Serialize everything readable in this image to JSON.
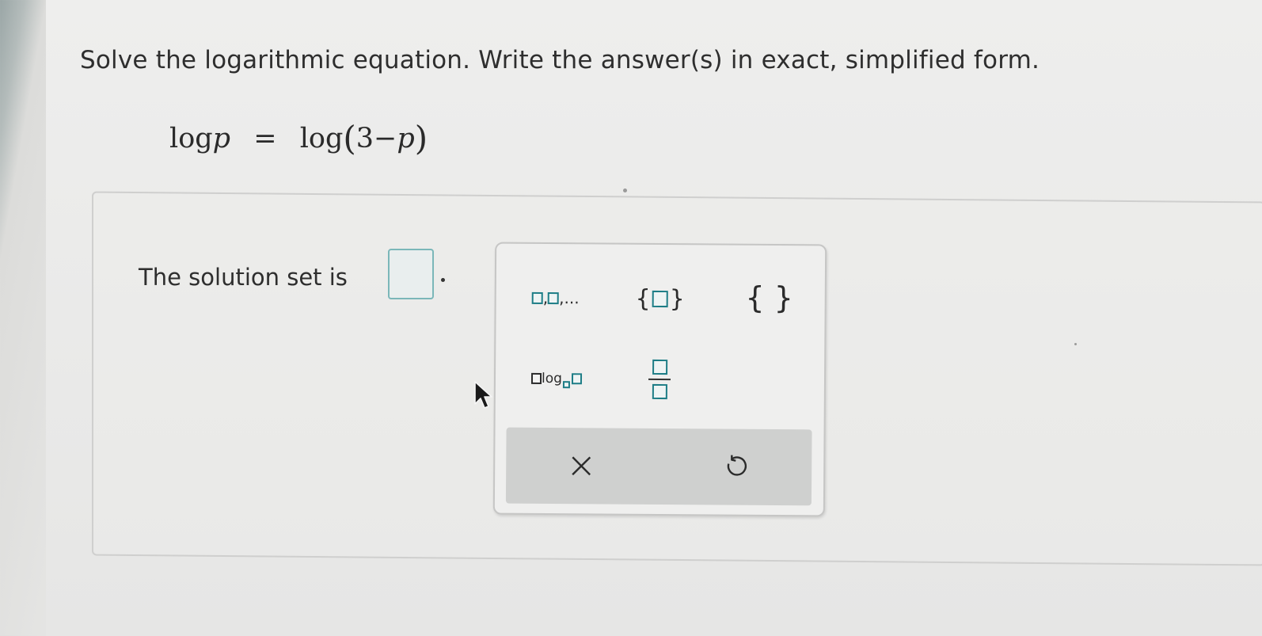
{
  "question": {
    "text": "Solve the logarithmic equation. Write the answer(s) in exact, simplified form."
  },
  "equation": {
    "lhs_fn": "log",
    "lhs_var": "p",
    "equals": "=",
    "rhs_fn": "log",
    "open_paren": "(",
    "rhs_num": "3",
    "minus": "−",
    "rhs_var": "p",
    "close_paren": ")"
  },
  "answer": {
    "prompt": "The solution set is",
    "value": "",
    "box_color": "#7bb7b9"
  },
  "palette": {
    "list_separator": ",",
    "list_ellipsis": ",...",
    "set_open": "{",
    "set_close": "}",
    "empty_set": "{ }",
    "log_label": "log",
    "template_box_color": "#1d7d86"
  },
  "actions": {
    "clear_icon": "close-x-icon",
    "undo_icon": "undo-arrow-icon"
  }
}
